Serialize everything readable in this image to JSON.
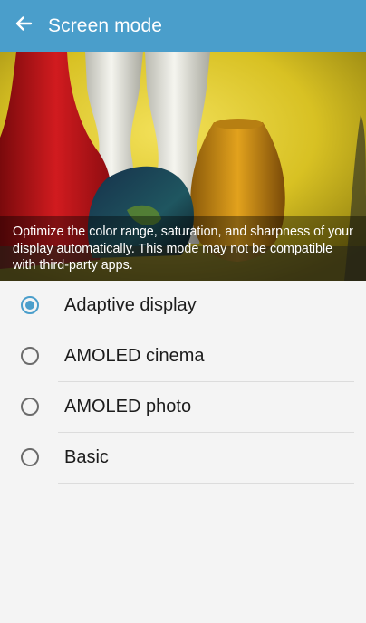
{
  "app_bar": {
    "title": "Screen mode",
    "back_icon": "arrow-left-icon",
    "background_color": "#4a9ecb"
  },
  "preview": {
    "caption": "Optimize the color range, saturation, and sharpness of your display automatically. This mode may not be compatible with third-party apps."
  },
  "options": [
    {
      "label": "Adaptive display",
      "selected": true
    },
    {
      "label": "AMOLED cinema",
      "selected": false
    },
    {
      "label": "AMOLED photo",
      "selected": false
    },
    {
      "label": "Basic",
      "selected": false
    }
  ],
  "colors": {
    "accent": "#4a9ecb",
    "background": "#f4f4f4"
  }
}
